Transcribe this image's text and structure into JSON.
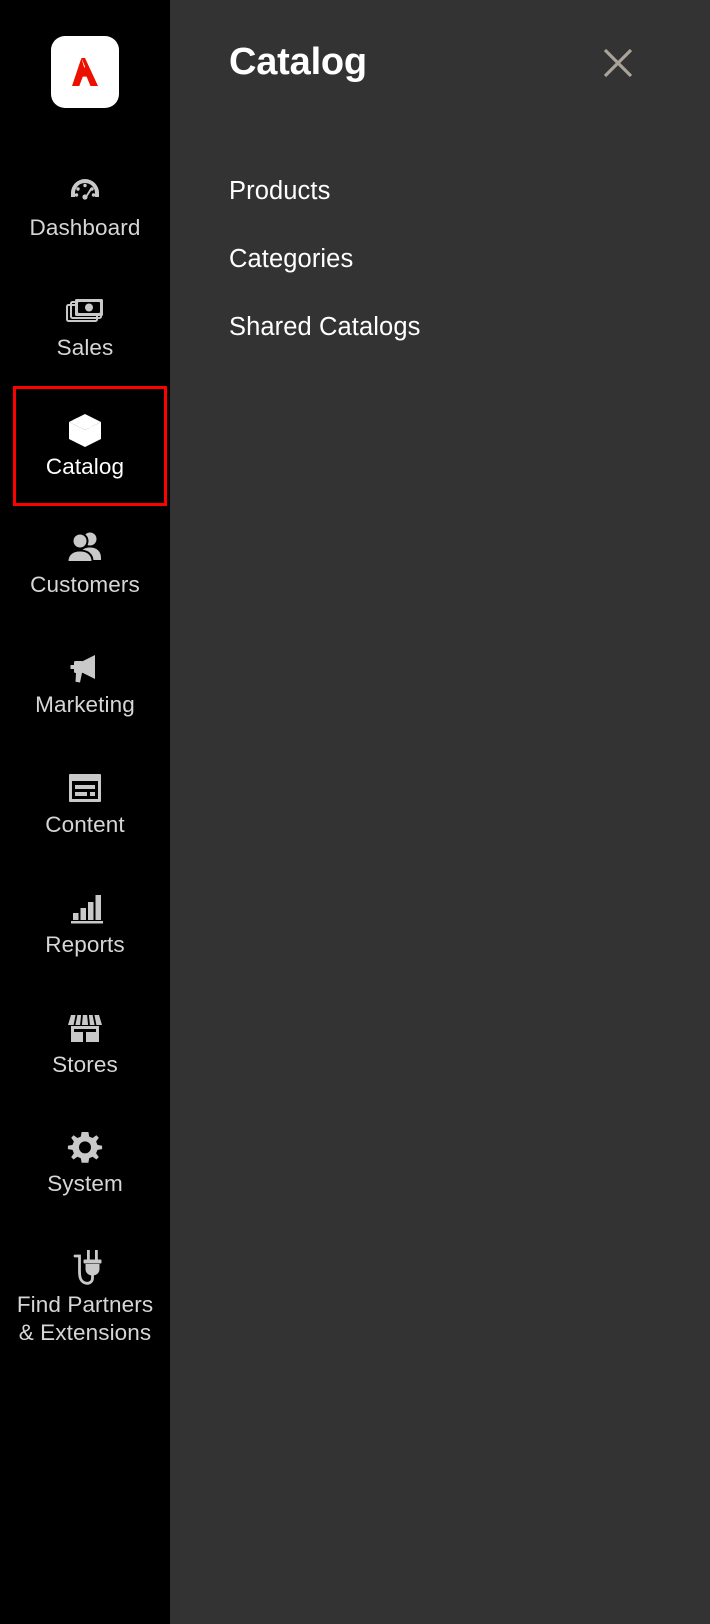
{
  "colors": {
    "sidebar_bg": "#000000",
    "panel_bg": "#333333",
    "highlight_border": "#ff0000",
    "brand_red": "#eb1000",
    "icon_gray": "#c9c9c9",
    "label_gray": "#d6d6d6",
    "close_icon": "#a9a399"
  },
  "sidebar": {
    "logo": {
      "name": "adobe-commerce-logo",
      "tile_color": "#ffffff",
      "mark_color": "#eb1000"
    },
    "items": [
      {
        "label": "Dashboard",
        "icon": "dashboard-gauge-icon",
        "active": false
      },
      {
        "label": "Sales",
        "icon": "sales-money-icon",
        "active": false
      },
      {
        "label": "Catalog",
        "icon": "catalog-box-icon",
        "active": true
      },
      {
        "label": "Customers",
        "icon": "customers-people-icon",
        "active": false
      },
      {
        "label": "Marketing",
        "icon": "marketing-megaphone-icon",
        "active": false
      },
      {
        "label": "Content",
        "icon": "content-layout-icon",
        "active": false
      },
      {
        "label": "Reports",
        "icon": "reports-bar-chart-icon",
        "active": false
      },
      {
        "label": "Stores",
        "icon": "stores-storefront-icon",
        "active": false
      },
      {
        "label": "System",
        "icon": "system-gear-icon",
        "active": false
      },
      {
        "label": "Find Partners\n& Extensions",
        "icon": "extensions-plug-icon",
        "active": false
      }
    ]
  },
  "panel": {
    "title": "Catalog",
    "close_icon": "close-x-icon",
    "menu": [
      {
        "label": "Products"
      },
      {
        "label": "Categories"
      },
      {
        "label": "Shared Catalogs"
      }
    ]
  }
}
